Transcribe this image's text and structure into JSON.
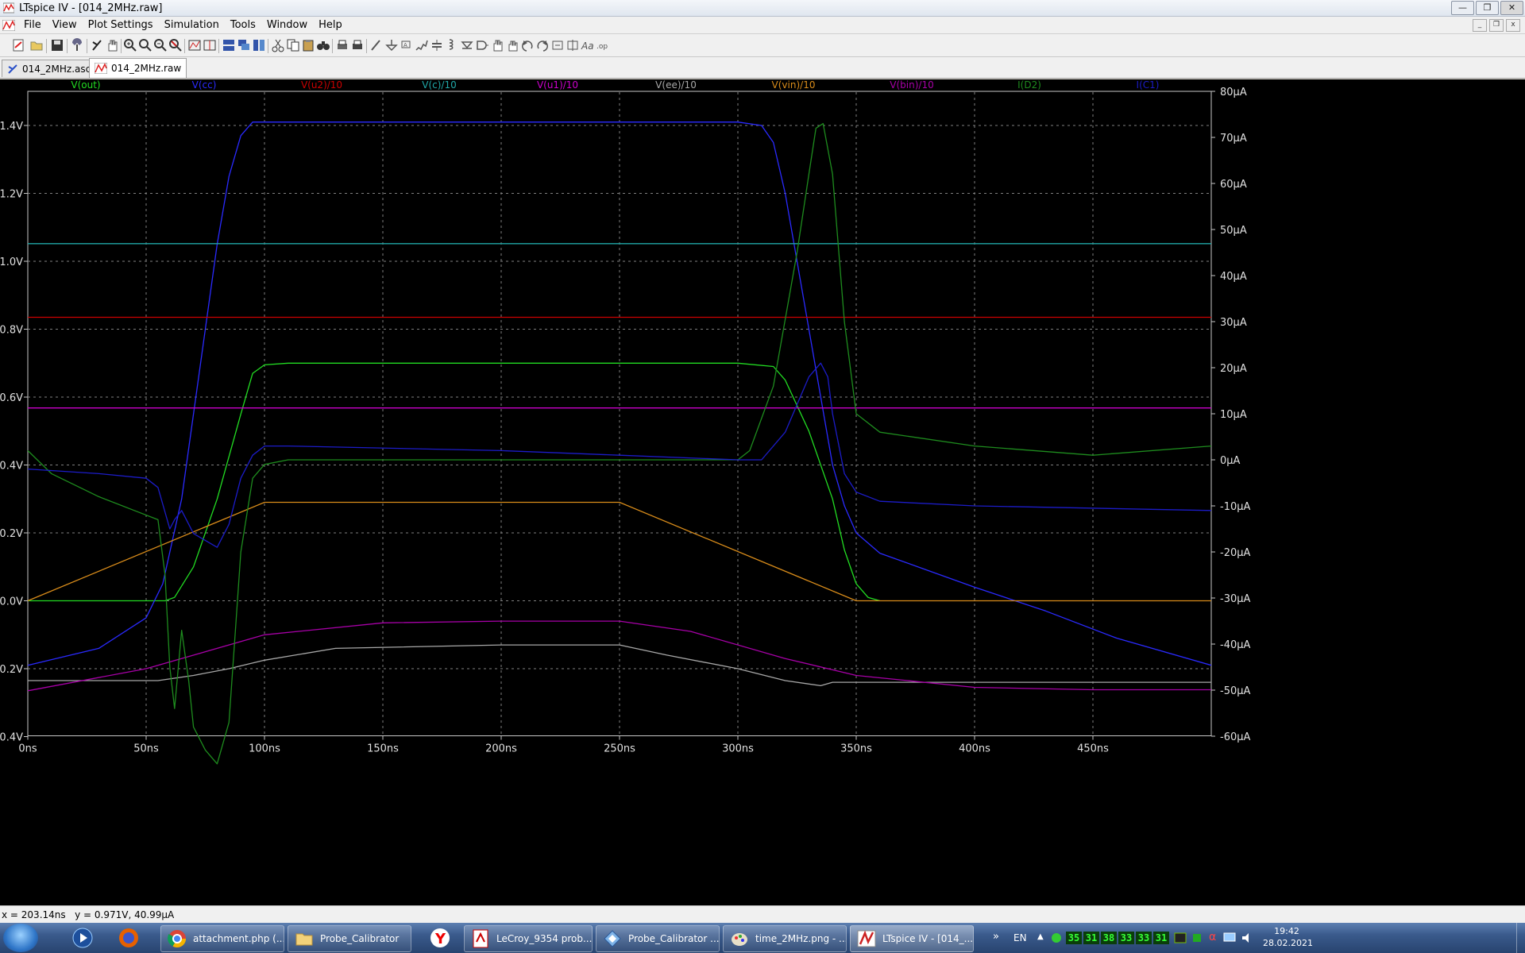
{
  "window": {
    "title": "LTspice IV - [014_2MHz.raw]"
  },
  "menu": [
    {
      "label": "File"
    },
    {
      "label": "View"
    },
    {
      "label": "Plot Settings"
    },
    {
      "label": "Simulation"
    },
    {
      "label": "Tools"
    },
    {
      "label": "Window"
    },
    {
      "label": "Help"
    }
  ],
  "tabs": [
    {
      "label": "014_2MHz.asc",
      "icon": "schematic-icon",
      "active": false
    },
    {
      "label": "014_2MHz.raw",
      "icon": "waveform-icon",
      "active": true
    }
  ],
  "status": {
    "cursor_x": "x = 203.14ns",
    "cursor_y": "y = 0.971V, 40.99µA"
  },
  "chart_data": {
    "type": "line",
    "xlabel": "",
    "ylabel": "",
    "grid": true,
    "xlim": [
      0,
      500
    ],
    "ylim_left": [
      -0.4,
      1.5
    ],
    "ylim_right": [
      -60,
      80
    ],
    "x_ticks": [
      "0ns",
      "50ns",
      "100ns",
      "150ns",
      "200ns",
      "250ns",
      "300ns",
      "350ns",
      "400ns",
      "450ns"
    ],
    "y_ticks_left": [
      "1.4V",
      "1.2V",
      "1.0V",
      "0.8V",
      "0.6V",
      "0.4V",
      "0.2V",
      "0.0V",
      "-0.2V",
      "-0.4V"
    ],
    "y_ticks_right": [
      "80µA",
      "70µA",
      "60µA",
      "50µA",
      "40µA",
      "30µA",
      "20µA",
      "10µA",
      "0µA",
      "-10µA",
      "-20µA",
      "-30µA",
      "-40µA",
      "-50µA",
      "-60µA"
    ],
    "series": [
      {
        "name": "V(out)",
        "color": "#22dd22",
        "axis": "left",
        "x": [
          0,
          55,
          58,
          62,
          70,
          80,
          90,
          95,
          100,
          110,
          250,
          300,
          315,
          320,
          330,
          340,
          345,
          350,
          355,
          360
        ],
        "y": [
          0,
          0,
          0,
          0.01,
          0.1,
          0.3,
          0.55,
          0.67,
          0.695,
          0.7,
          0.7,
          0.7,
          0.69,
          0.65,
          0.5,
          0.3,
          0.15,
          0.05,
          0.01,
          0
        ]
      },
      {
        "name": "V(cc)",
        "color": "#2a2aff",
        "axis": "left",
        "x": [
          0,
          30,
          50,
          57,
          65,
          70,
          75,
          80,
          85,
          90,
          95,
          100,
          110,
          250,
          300,
          310,
          315,
          320,
          325,
          330,
          335,
          340,
          345,
          350,
          360,
          380,
          400,
          430,
          460,
          500
        ],
        "y": [
          -0.19,
          -0.14,
          -0.05,
          0.05,
          0.3,
          0.55,
          0.8,
          1.05,
          1.25,
          1.37,
          1.41,
          1.41,
          1.41,
          1.41,
          1.41,
          1.4,
          1.35,
          1.2,
          1.0,
          0.8,
          0.6,
          0.4,
          0.28,
          0.2,
          0.14,
          0.09,
          0.04,
          -0.03,
          -0.11,
          -0.19
        ]
      },
      {
        "name": "V(u2)/10",
        "color": "#cc0000",
        "axis": "left",
        "x": [
          0,
          500
        ],
        "y": [
          0.835,
          0.835
        ]
      },
      {
        "name": "V(c)/10",
        "color": "#20a8a8",
        "axis": "left",
        "x": [
          0,
          500
        ],
        "y": [
          1.052,
          1.052
        ]
      },
      {
        "name": "V(u1)/10",
        "color": "#cc00cc",
        "axis": "left",
        "x": [
          0,
          500
        ],
        "y": [
          0.568,
          0.568
        ]
      },
      {
        "name": "V(ee)/10",
        "color": "#a8a8a8",
        "axis": "left",
        "x": [
          0,
          55,
          70,
          85,
          100,
          130,
          200,
          250,
          270,
          300,
          320,
          335,
          340,
          500
        ],
        "y": [
          -0.235,
          -0.235,
          -0.22,
          -0.2,
          -0.175,
          -0.14,
          -0.13,
          -0.13,
          -0.16,
          -0.2,
          -0.235,
          -0.25,
          -0.24,
          -0.24
        ]
      },
      {
        "name": "V(vin)/10",
        "color": "#d98c1a",
        "axis": "left",
        "x": [
          0,
          100,
          250,
          350,
          360,
          500
        ],
        "y": [
          0,
          0.29,
          0.29,
          0,
          0,
          0
        ]
      },
      {
        "name": "V(bin)/10",
        "color": "#a800a8",
        "axis": "left",
        "x": [
          0,
          50,
          100,
          150,
          200,
          250,
          280,
          320,
          350,
          400,
          450,
          500
        ],
        "y": [
          -0.265,
          -0.2,
          -0.1,
          -0.065,
          -0.06,
          -0.06,
          -0.09,
          -0.17,
          -0.22,
          -0.255,
          -0.262,
          -0.262
        ]
      },
      {
        "name": "I(D2)",
        "color": "#1e8c1e",
        "axis": "right",
        "x": [
          0,
          10,
          30,
          45,
          55,
          58,
          60,
          62,
          65,
          68,
          70,
          75,
          80,
          85,
          88,
          90,
          95,
          100,
          110,
          150,
          250,
          300,
          305,
          315,
          325,
          330,
          333,
          336,
          340,
          345,
          350,
          360,
          400,
          450,
          500
        ],
        "y": [
          2,
          -3,
          -8,
          -11,
          -13,
          -25,
          -45,
          -54,
          -37,
          -48,
          -58,
          -63,
          -66,
          -57,
          -35,
          -20,
          -4,
          -1,
          0,
          0,
          0,
          0,
          2,
          16,
          45,
          62,
          72,
          73,
          62,
          30,
          10,
          6,
          3,
          1,
          3
        ]
      },
      {
        "name": "I(C1)",
        "color": "#1c1cc8",
        "axis": "right",
        "x": [
          0,
          30,
          50,
          55,
          60,
          62,
          65,
          70,
          80,
          85,
          90,
          95,
          100,
          110,
          200,
          250,
          300,
          310,
          320,
          330,
          335,
          338,
          340,
          345,
          350,
          360,
          400,
          500
        ],
        "y": [
          -2,
          -3,
          -4,
          -6,
          -15,
          -13,
          -11,
          -16,
          -19,
          -14,
          -4,
          1,
          3,
          3,
          2,
          1,
          0,
          0,
          6,
          18,
          21,
          18,
          10,
          -3,
          -7,
          -9,
          -10,
          -11
        ]
      }
    ]
  }
}
